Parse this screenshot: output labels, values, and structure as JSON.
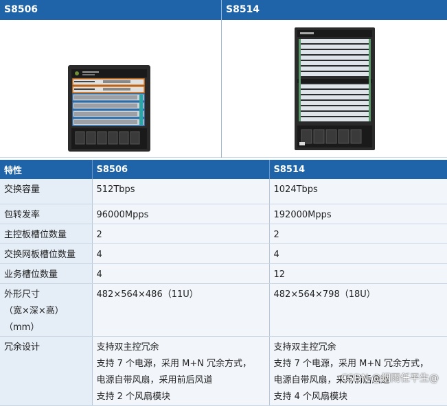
{
  "models": [
    {
      "name": "S8506"
    },
    {
      "name": "S8514"
    }
  ],
  "table": {
    "headers": [
      "特性",
      "S8506",
      "S8514"
    ],
    "rows": [
      {
        "feature": "交换容量",
        "s8506": "512Tbps",
        "s8514": "1024Tbps"
      },
      {
        "feature": "包转发率",
        "s8506": "96000Mpps",
        "s8514": "192000Mpps"
      },
      {
        "feature": "主控板槽位数量",
        "s8506": "2",
        "s8514": "2"
      },
      {
        "feature": "交换网板槽位数量",
        "s8506": "4",
        "s8514": "4"
      },
      {
        "feature": "业务槽位数量",
        "s8506": "4",
        "s8514": "12"
      },
      {
        "feature": [
          "外形尺寸",
          "（宽×深×高）",
          "（mm）"
        ],
        "s8506": [
          "482×564×486（11U）"
        ],
        "s8514": [
          "482×564×798（18U）"
        ]
      },
      {
        "feature": [
          "冗余设计"
        ],
        "s8506": [
          "支持双主控冗余",
          "支持 7 个电源，采用 M+N 冗余方式，",
          "电源自带风扇，采用前后风道",
          "支持 2 个风扇模块"
        ],
        "s8514": [
          "支持双主控冗余",
          "支持 7 个电源，采用 M+N 冗余方式，",
          "电源自带风扇，采用前后风道",
          "支持 4 个风扇模块"
        ]
      }
    ]
  },
  "watermark": "CSDN @烟雨任平生@",
  "colors": {
    "header_bg": "#1f64a8",
    "feature_bg": "#e5edf7",
    "value_bg": "#f2f6fb"
  }
}
